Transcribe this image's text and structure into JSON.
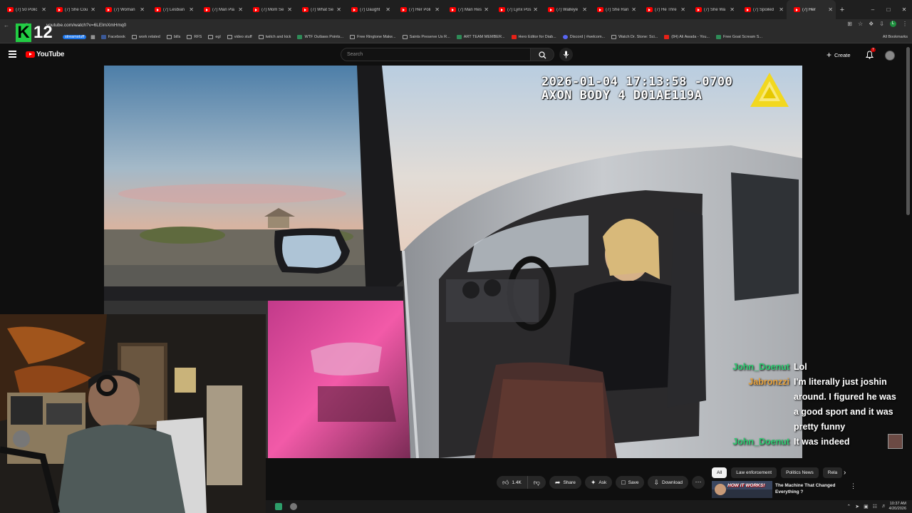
{
  "browser": {
    "tabs": [
      {
        "label": "(7) 50 Polic"
      },
      {
        "label": "(7) She Cou"
      },
      {
        "label": "(7) Woman"
      },
      {
        "label": "(7) Lesbian"
      },
      {
        "label": "(7) Man Pla"
      },
      {
        "label": "(7) Mom Se"
      },
      {
        "label": "(7) What Se"
      },
      {
        "label": "(7) Daught"
      },
      {
        "label": "(7) Her Poli"
      },
      {
        "label": "(7) Man Res"
      },
      {
        "label": "(7) Lynx Pos"
      },
      {
        "label": "(7) Walleye"
      },
      {
        "label": "(7) She Ran"
      },
      {
        "label": "(7) He Thre"
      },
      {
        "label": "(7) She Wa"
      },
      {
        "label": "(7) Spoiled"
      },
      {
        "label": "(7) Her"
      }
    ],
    "url": "youtube.com/watch?v=6LElmXmHmq0",
    "bookmarks": [
      {
        "label": "Facebook",
        "icon": "app"
      },
      {
        "label": "work related",
        "icon": "folder"
      },
      {
        "label": "bills",
        "icon": "folder"
      },
      {
        "label": "RFS",
        "icon": "folder"
      },
      {
        "label": "egl",
        "icon": "folder"
      },
      {
        "label": "video stuff",
        "icon": "folder"
      },
      {
        "label": "twitch and kick",
        "icon": "folder"
      },
      {
        "label": "WTF Outlaws Points...",
        "icon": "grn"
      },
      {
        "label": "Free Ringtone Make...",
        "icon": "folder"
      },
      {
        "label": "Saints Preserve Us R...",
        "icon": "folder"
      },
      {
        "label": "ART TEAM MEMBER...",
        "icon": "grn"
      },
      {
        "label": "Hero Editor for Diab...",
        "icon": "red"
      },
      {
        "label": "Discord | #welcom...",
        "icon": "blu"
      },
      {
        "label": "Watch Dr. Stone: Sci...",
        "icon": "folder"
      },
      {
        "label": "(84) Ali Awada - You...",
        "icon": "red"
      },
      {
        "label": "Free Goat Scream S...",
        "icon": "grn"
      }
    ],
    "streamstuff_label": "streamstuff",
    "all_bookmarks": "All Bookmarks",
    "profile_initial": "L"
  },
  "overlay": {
    "logo_letter": "K",
    "logo_number": "12"
  },
  "youtube": {
    "logo_text": "YouTube",
    "search_placeholder": "Search",
    "create_label": "Create",
    "notif_count": "7"
  },
  "video": {
    "timestamp_line1": "2026-01-04 17:13:58 -0700",
    "timestamp_line2": "AXON BODY 4 D01AE119A"
  },
  "chat": [
    {
      "user": "John_Doenut",
      "color": "#2ecc71",
      "text": "Lol"
    },
    {
      "user": "Jabronzzi",
      "color": "#e8a33d",
      "text": "I'm literally just joshin around. I figured he was a good sport and it was pretty funny"
    },
    {
      "user": "John_Doenut",
      "color": "#2ecc71",
      "text": "It was indeed"
    }
  ],
  "actions": {
    "like_count": "1.4K",
    "share": "Share",
    "ask": "Ask",
    "save": "Save",
    "download": "Download"
  },
  "chips": [
    "All",
    "Law enforcement",
    "Politics News",
    "Rela"
  ],
  "upnext": {
    "title": "The Machine That Changed Everything ?",
    "thumb_text": "HOW IT WORKS!"
  },
  "taskbar": {
    "time": "10:37 AM",
    "date": "4/20/2026"
  }
}
